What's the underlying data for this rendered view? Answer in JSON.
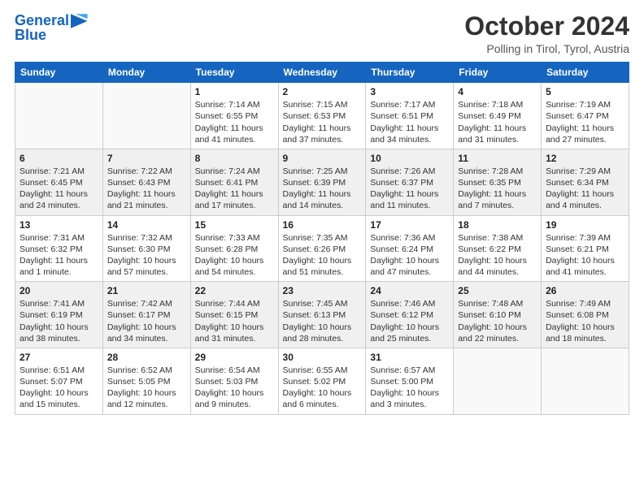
{
  "logo": {
    "line1": "General",
    "line2": "Blue",
    "icon": "▶"
  },
  "header": {
    "month": "October 2024",
    "location": "Polling in Tirol, Tyrol, Austria"
  },
  "weekdays": [
    "Sunday",
    "Monday",
    "Tuesday",
    "Wednesday",
    "Thursday",
    "Friday",
    "Saturday"
  ],
  "weeks": [
    [
      {
        "day": "",
        "detail": ""
      },
      {
        "day": "",
        "detail": ""
      },
      {
        "day": "1",
        "detail": "Sunrise: 7:14 AM\nSunset: 6:55 PM\nDaylight: 11 hours and 41 minutes."
      },
      {
        "day": "2",
        "detail": "Sunrise: 7:15 AM\nSunset: 6:53 PM\nDaylight: 11 hours and 37 minutes."
      },
      {
        "day": "3",
        "detail": "Sunrise: 7:17 AM\nSunset: 6:51 PM\nDaylight: 11 hours and 34 minutes."
      },
      {
        "day": "4",
        "detail": "Sunrise: 7:18 AM\nSunset: 6:49 PM\nDaylight: 11 hours and 31 minutes."
      },
      {
        "day": "5",
        "detail": "Sunrise: 7:19 AM\nSunset: 6:47 PM\nDaylight: 11 hours and 27 minutes."
      }
    ],
    [
      {
        "day": "6",
        "detail": "Sunrise: 7:21 AM\nSunset: 6:45 PM\nDaylight: 11 hours and 24 minutes."
      },
      {
        "day": "7",
        "detail": "Sunrise: 7:22 AM\nSunset: 6:43 PM\nDaylight: 11 hours and 21 minutes."
      },
      {
        "day": "8",
        "detail": "Sunrise: 7:24 AM\nSunset: 6:41 PM\nDaylight: 11 hours and 17 minutes."
      },
      {
        "day": "9",
        "detail": "Sunrise: 7:25 AM\nSunset: 6:39 PM\nDaylight: 11 hours and 14 minutes."
      },
      {
        "day": "10",
        "detail": "Sunrise: 7:26 AM\nSunset: 6:37 PM\nDaylight: 11 hours and 11 minutes."
      },
      {
        "day": "11",
        "detail": "Sunrise: 7:28 AM\nSunset: 6:35 PM\nDaylight: 11 hours and 7 minutes."
      },
      {
        "day": "12",
        "detail": "Sunrise: 7:29 AM\nSunset: 6:34 PM\nDaylight: 11 hours and 4 minutes."
      }
    ],
    [
      {
        "day": "13",
        "detail": "Sunrise: 7:31 AM\nSunset: 6:32 PM\nDaylight: 11 hours and 1 minute."
      },
      {
        "day": "14",
        "detail": "Sunrise: 7:32 AM\nSunset: 6:30 PM\nDaylight: 10 hours and 57 minutes."
      },
      {
        "day": "15",
        "detail": "Sunrise: 7:33 AM\nSunset: 6:28 PM\nDaylight: 10 hours and 54 minutes."
      },
      {
        "day": "16",
        "detail": "Sunrise: 7:35 AM\nSunset: 6:26 PM\nDaylight: 10 hours and 51 minutes."
      },
      {
        "day": "17",
        "detail": "Sunrise: 7:36 AM\nSunset: 6:24 PM\nDaylight: 10 hours and 47 minutes."
      },
      {
        "day": "18",
        "detail": "Sunrise: 7:38 AM\nSunset: 6:22 PM\nDaylight: 10 hours and 44 minutes."
      },
      {
        "day": "19",
        "detail": "Sunrise: 7:39 AM\nSunset: 6:21 PM\nDaylight: 10 hours and 41 minutes."
      }
    ],
    [
      {
        "day": "20",
        "detail": "Sunrise: 7:41 AM\nSunset: 6:19 PM\nDaylight: 10 hours and 38 minutes."
      },
      {
        "day": "21",
        "detail": "Sunrise: 7:42 AM\nSunset: 6:17 PM\nDaylight: 10 hours and 34 minutes."
      },
      {
        "day": "22",
        "detail": "Sunrise: 7:44 AM\nSunset: 6:15 PM\nDaylight: 10 hours and 31 minutes."
      },
      {
        "day": "23",
        "detail": "Sunrise: 7:45 AM\nSunset: 6:13 PM\nDaylight: 10 hours and 28 minutes."
      },
      {
        "day": "24",
        "detail": "Sunrise: 7:46 AM\nSunset: 6:12 PM\nDaylight: 10 hours and 25 minutes."
      },
      {
        "day": "25",
        "detail": "Sunrise: 7:48 AM\nSunset: 6:10 PM\nDaylight: 10 hours and 22 minutes."
      },
      {
        "day": "26",
        "detail": "Sunrise: 7:49 AM\nSunset: 6:08 PM\nDaylight: 10 hours and 18 minutes."
      }
    ],
    [
      {
        "day": "27",
        "detail": "Sunrise: 6:51 AM\nSunset: 5:07 PM\nDaylight: 10 hours and 15 minutes."
      },
      {
        "day": "28",
        "detail": "Sunrise: 6:52 AM\nSunset: 5:05 PM\nDaylight: 10 hours and 12 minutes."
      },
      {
        "day": "29",
        "detail": "Sunrise: 6:54 AM\nSunset: 5:03 PM\nDaylight: 10 hours and 9 minutes."
      },
      {
        "day": "30",
        "detail": "Sunrise: 6:55 AM\nSunset: 5:02 PM\nDaylight: 10 hours and 6 minutes."
      },
      {
        "day": "31",
        "detail": "Sunrise: 6:57 AM\nSunset: 5:00 PM\nDaylight: 10 hours and 3 minutes."
      },
      {
        "day": "",
        "detail": ""
      },
      {
        "day": "",
        "detail": ""
      }
    ]
  ]
}
